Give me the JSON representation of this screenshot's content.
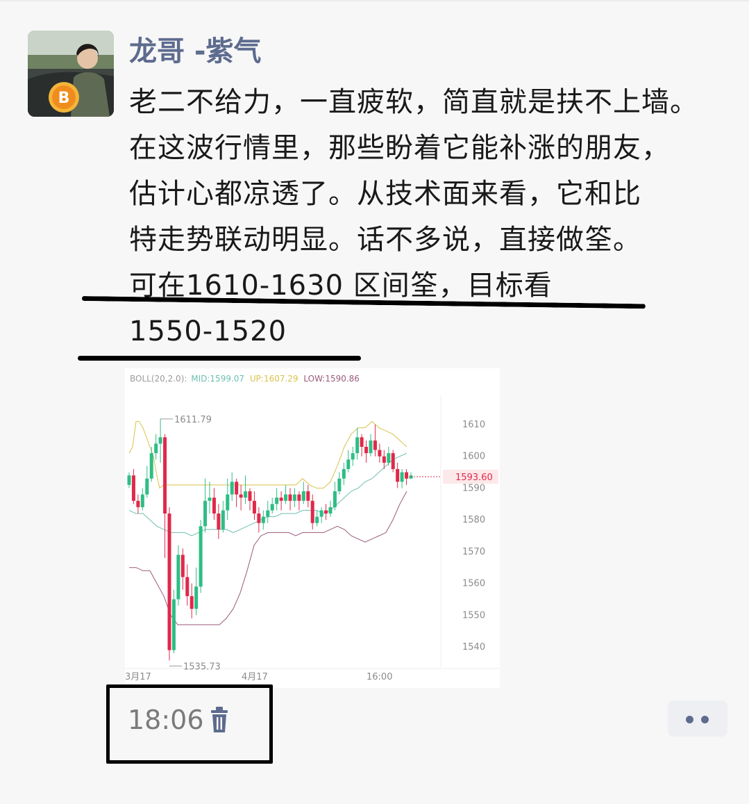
{
  "author": {
    "name": "龙哥 -紫气",
    "avatar_icon": "avatar-photo-bitcoin"
  },
  "post": {
    "lines": [
      "老二不给力，一直疲软，简直就是扶不上墙。",
      "在这波行情里，那些盼着它能补涨的朋友，",
      "估计心都凉透了。从技术面来看，它和比",
      "特走势联动明显。话不多说，直接做筌。",
      "可在1610-1630 区间筌，目标看",
      "1550-1520"
    ]
  },
  "chart": {
    "legend": {
      "boll": "BOLL(20,2.0):",
      "mid": "MID:1599.07",
      "up": "UP:1607.29",
      "low": "LOW:1590.86"
    },
    "colors": {
      "up_candle": "#2ebd85",
      "down_candle": "#e0294a",
      "mid": "#6cbfb0",
      "upper": "#d8c24a",
      "lower": "#9a5a7a",
      "last_price": "#e0294a"
    },
    "y_ticks": [
      "1610",
      "1600",
      "1590",
      "1580",
      "1570",
      "1560",
      "1550",
      "1540"
    ],
    "x_ticks": [
      "3月17",
      "4月17",
      "16:00"
    ],
    "high_label": "1611.79",
    "low_label": "1535.73",
    "last_price_label": "1593.60"
  },
  "chart_data": {
    "type": "candlestick",
    "title": "BOLL(20,2.0)",
    "ylim": [
      1537,
      1615
    ],
    "x": [
      "3月17",
      "4月17",
      "16:00"
    ],
    "y_ticks": [
      1610,
      1600,
      1590,
      1580,
      1570,
      1560,
      1550,
      1540
    ],
    "high": 1611.79,
    "low": 1535.73,
    "last": 1593.6,
    "candles": [
      [
        1591,
        1594,
        1595,
        1590
      ],
      [
        1594,
        1586,
        1596,
        1585
      ],
      [
        1586,
        1584,
        1588,
        1582
      ],
      [
        1584,
        1588,
        1590,
        1583
      ],
      [
        1588,
        1593,
        1597,
        1587
      ],
      [
        1593,
        1601,
        1603,
        1592
      ],
      [
        1601,
        1604,
        1607,
        1599
      ],
      [
        1604,
        1606,
        1611.79,
        1598
      ],
      [
        1606,
        1582,
        1607,
        1568
      ],
      [
        1582,
        1539,
        1584,
        1535.73
      ],
      [
        1539,
        1555,
        1558,
        1538
      ],
      [
        1555,
        1569,
        1572,
        1553
      ],
      [
        1569,
        1562,
        1571,
        1558
      ],
      [
        1562,
        1556,
        1566,
        1553
      ],
      [
        1556,
        1552,
        1560,
        1549
      ],
      [
        1552,
        1559,
        1565,
        1550
      ],
      [
        1559,
        1578,
        1580,
        1557
      ],
      [
        1578,
        1586,
        1593,
        1576
      ],
      [
        1586,
        1587,
        1592,
        1582
      ],
      [
        1587,
        1582,
        1590,
        1580
      ],
      [
        1582,
        1577,
        1585,
        1574
      ],
      [
        1577,
        1583,
        1586,
        1576
      ],
      [
        1583,
        1588,
        1593,
        1580
      ],
      [
        1588,
        1592,
        1595,
        1586
      ],
      [
        1592,
        1588,
        1593,
        1584
      ],
      [
        1588,
        1587,
        1591,
        1583
      ],
      [
        1587,
        1589,
        1594,
        1585
      ],
      [
        1589,
        1586,
        1590,
        1583
      ],
      [
        1586,
        1582,
        1589,
        1580
      ],
      [
        1582,
        1579,
        1584,
        1576
      ],
      [
        1579,
        1581,
        1583,
        1577
      ],
      [
        1581,
        1583,
        1586,
        1579
      ],
      [
        1583,
        1585,
        1587,
        1582
      ],
      [
        1585,
        1587,
        1590,
        1583
      ],
      [
        1587,
        1586,
        1589,
        1583
      ],
      [
        1586,
        1588,
        1591,
        1585
      ],
      [
        1588,
        1586,
        1590,
        1583
      ],
      [
        1586,
        1588,
        1590,
        1584
      ],
      [
        1588,
        1586,
        1589,
        1583
      ],
      [
        1586,
        1589,
        1592,
        1585
      ],
      [
        1589,
        1586,
        1591,
        1584
      ],
      [
        1586,
        1579,
        1588,
        1577
      ],
      [
        1579,
        1581,
        1583,
        1578
      ],
      [
        1581,
        1583,
        1584,
        1579
      ],
      [
        1583,
        1582,
        1585,
        1580
      ],
      [
        1582,
        1584,
        1586,
        1581
      ],
      [
        1584,
        1589,
        1592,
        1583
      ],
      [
        1589,
        1593,
        1595,
        1588
      ],
      [
        1593,
        1596,
        1598,
        1591
      ],
      [
        1596,
        1599,
        1602,
        1595
      ],
      [
        1599,
        1601,
        1603,
        1597
      ],
      [
        1601,
        1606,
        1609,
        1599
      ],
      [
        1606,
        1603,
        1607,
        1600
      ],
      [
        1603,
        1601,
        1605,
        1598
      ],
      [
        1601,
        1605,
        1607,
        1600
      ],
      [
        1605,
        1602,
        1610,
        1600
      ],
      [
        1602,
        1600,
        1604,
        1598
      ],
      [
        1600,
        1598,
        1602,
        1596
      ],
      [
        1598,
        1601,
        1603,
        1597
      ],
      [
        1601,
        1596,
        1602,
        1595
      ],
      [
        1596,
        1592,
        1598,
        1590
      ],
      [
        1592,
        1595,
        1596,
        1590
      ],
      [
        1595,
        1593,
        1596,
        1591
      ],
      [
        1593,
        1594,
        1595,
        1593
      ]
    ],
    "series": [
      {
        "name": "UP",
        "values": [
          [
            0,
            1601
          ],
          [
            5,
            1603
          ],
          [
            10,
            1611
          ],
          [
            14,
            1611
          ],
          [
            20,
            1609
          ],
          [
            25,
            1606
          ],
          [
            30,
            1603
          ],
          [
            35,
            1600
          ],
          [
            40,
            1594
          ],
          [
            44,
            1590
          ],
          [
            50,
            1591
          ],
          [
            60,
            1591
          ],
          [
            70,
            1591
          ],
          [
            80,
            1591
          ],
          [
            90,
            1591
          ],
          [
            100,
            1591
          ],
          [
            110,
            1591
          ],
          [
            120,
            1591
          ],
          [
            130,
            1591
          ],
          [
            140,
            1591
          ],
          [
            150,
            1591
          ],
          [
            160,
            1591
          ],
          [
            170,
            1591
          ],
          [
            180,
            1591
          ],
          [
            190,
            1591
          ],
          [
            200,
            1591
          ],
          [
            210,
            1591
          ],
          [
            220,
            1591
          ],
          [
            230,
            1591
          ],
          [
            240,
            1591
          ],
          [
            250,
            1593
          ],
          [
            260,
            1591
          ],
          [
            270,
            1590
          ],
          [
            280,
            1590
          ],
          [
            290,
            1592
          ],
          [
            300,
            1597
          ],
          [
            310,
            1603
          ],
          [
            320,
            1607
          ],
          [
            330,
            1609
          ],
          [
            340,
            1609
          ],
          [
            350,
            1611
          ],
          [
            360,
            1609
          ],
          [
            370,
            1608
          ],
          [
            380,
            1607
          ],
          [
            390,
            1605
          ],
          [
            400,
            1603
          ]
        ]
      },
      {
        "name": "MID",
        "values": [
          [
            0,
            1583
          ],
          [
            10,
            1582
          ],
          [
            20,
            1582
          ],
          [
            30,
            1580
          ],
          [
            40,
            1578
          ],
          [
            50,
            1577
          ],
          [
            60,
            1576
          ],
          [
            70,
            1576
          ],
          [
            80,
            1576
          ],
          [
            90,
            1575
          ],
          [
            100,
            1576
          ],
          [
            110,
            1577
          ],
          [
            120,
            1577
          ],
          [
            130,
            1577
          ],
          [
            140,
            1577
          ],
          [
            150,
            1576
          ],
          [
            160,
            1577
          ],
          [
            170,
            1578
          ],
          [
            180,
            1579
          ],
          [
            190,
            1580
          ],
          [
            200,
            1581
          ],
          [
            210,
            1581
          ],
          [
            220,
            1582
          ],
          [
            230,
            1582
          ],
          [
            240,
            1582
          ],
          [
            250,
            1583
          ],
          [
            260,
            1583
          ],
          [
            270,
            1583
          ],
          [
            280,
            1582
          ],
          [
            290,
            1583
          ],
          [
            300,
            1585
          ],
          [
            310,
            1587
          ],
          [
            320,
            1589
          ],
          [
            330,
            1590
          ],
          [
            340,
            1592
          ],
          [
            350,
            1593
          ],
          [
            360,
            1595
          ],
          [
            370,
            1597
          ],
          [
            380,
            1599
          ],
          [
            390,
            1600
          ],
          [
            400,
            1601
          ]
        ]
      },
      {
        "name": "LOW",
        "values": [
          [
            0,
            1565
          ],
          [
            10,
            1565
          ],
          [
            20,
            1564
          ],
          [
            30,
            1564
          ],
          [
            40,
            1560
          ],
          [
            50,
            1556
          ],
          [
            60,
            1550
          ],
          [
            70,
            1547
          ],
          [
            80,
            1547
          ],
          [
            90,
            1547
          ],
          [
            100,
            1547
          ],
          [
            110,
            1547
          ],
          [
            120,
            1547
          ],
          [
            130,
            1547
          ],
          [
            140,
            1549
          ],
          [
            150,
            1552
          ],
          [
            160,
            1557
          ],
          [
            170,
            1564
          ],
          [
            180,
            1572
          ],
          [
            190,
            1575
          ],
          [
            200,
            1576
          ],
          [
            210,
            1576
          ],
          [
            220,
            1576
          ],
          [
            230,
            1576
          ],
          [
            240,
            1575
          ],
          [
            250,
            1576
          ],
          [
            260,
            1576
          ],
          [
            270,
            1576
          ],
          [
            280,
            1576
          ],
          [
            290,
            1577
          ],
          [
            300,
            1578
          ],
          [
            310,
            1577
          ],
          [
            320,
            1575
          ],
          [
            330,
            1574
          ],
          [
            340,
            1573
          ],
          [
            350,
            1574
          ],
          [
            360,
            1575
          ],
          [
            370,
            1576
          ],
          [
            380,
            1580
          ],
          [
            390,
            1585
          ],
          [
            400,
            1589
          ]
        ]
      }
    ]
  }
}
